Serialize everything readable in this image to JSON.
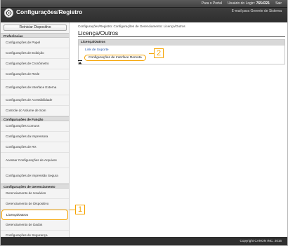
{
  "header": {
    "title": "Configurações/Registro",
    "portal_link": "Para o Portal",
    "login_label": "Usuário do Login:",
    "login_value": "7654321",
    "logout": "Sair",
    "email_admin": "E-mail para Gerente de Sistema"
  },
  "sidebar": {
    "restart_button": "Reiniciar Dispositivo",
    "sections": [
      {
        "title": "Preferências",
        "items": [
          "Configurações de Papel",
          "Configurações de Exibição",
          "Configurações de Cronômetro",
          "Configurações de Rede",
          "Configurações de Interface Externa",
          "Configurações de Acessibilidade",
          "Controle do Volume de Som"
        ]
      },
      {
        "title": "Configurações de Função",
        "items": [
          "Configurações Comuns",
          "Configurações da Impressora",
          "Configurações de RX",
          "Acessar Configurações de Arquivos",
          "Configurações de Impressão Segura"
        ]
      },
      {
        "title": "Configurações de Gerenciamento",
        "items": [
          "Gerenciamento de Usuários",
          "Gerenciamento de Dispositivo",
          "Licença/Outros",
          "Gerenciamento de Dados",
          "Configurações de Segurança"
        ]
      }
    ]
  },
  "main": {
    "breadcrumb": "Configurações/Registro: Configurações de Gerenciamento: Licença/Outros",
    "page_title": "Licença/Outros",
    "panel_title": "Licença/Outros",
    "link_support": "Link de Suporte",
    "link_remote_ui": "Configurações de Interface Remota"
  },
  "callouts": {
    "one": "1",
    "two": "2"
  },
  "footer": {
    "copyright": "Copyright CANON INC. 2016"
  },
  "colors": {
    "header_bg": "#3c3c3c",
    "highlight": "#f5a300",
    "link": "#2255aa"
  }
}
